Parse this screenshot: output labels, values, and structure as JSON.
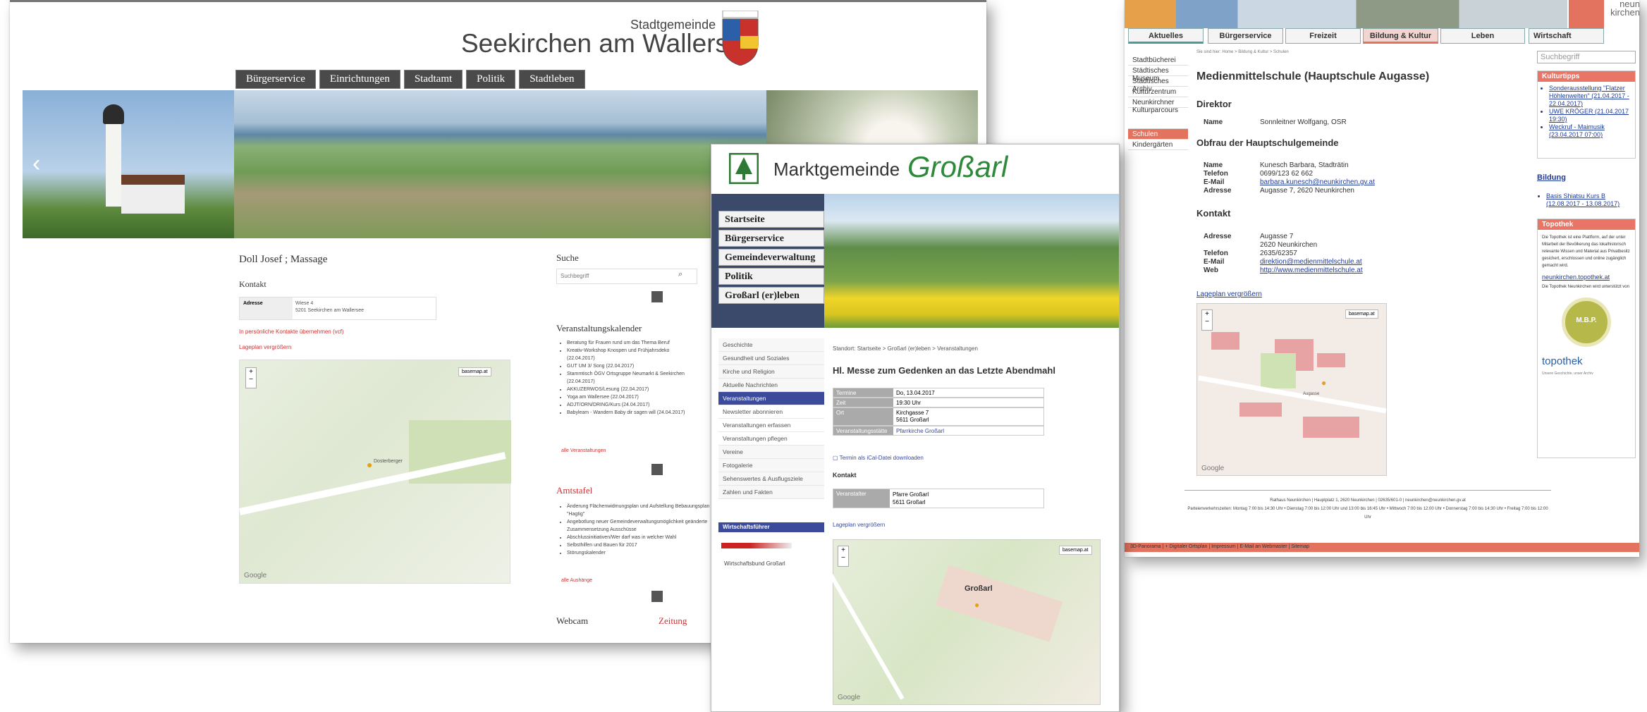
{
  "seekirchen": {
    "title_sub": "Stadtgemeinde",
    "title_main": "Seekirchen am Wallersee",
    "nav": [
      "Bürgerservice",
      "Einrichtungen",
      "Stadtamt",
      "Politik",
      "Stadtleben"
    ],
    "page_title": "Doll Josef ; Massage",
    "kontakt": "Kontakt",
    "adresse_label": "Adresse",
    "adresse_value": [
      "Wiese 4",
      "5201 Seekirchen am Wallersee"
    ],
    "vcard": "In persönliche Kontakte übernehmen (vcf)",
    "lageplan": "Lageplan vergrößern",
    "map_type": "basemap.at",
    "map_place": "Dosterberger",
    "google": "Google",
    "suche": "Suche",
    "suchbegriff": "Suchbegriff",
    "kalender_title": "Veranstaltungskalender",
    "kalender": [
      "Beratung für Frauen rund um das Thema Beruf",
      "Kreativ-Workshop Knospen und Frühjahrsdeko",
      "(22.04.2017)",
      "GUT UM 3/ Song (22.04.2017)",
      "Stammtisch ÖGV Ortsgruppe Neumarkt & Seekirchen",
      "(22.04.2017)",
      "AKKUZERWOS/Lesung (22.04.2017)",
      "Yoga am Wallersee (22.04.2017)",
      "ADJT/ORN/DRING/Kurs (24.04.2017)",
      "Babyleam - Wandern Baby dir sagen will (24.04.2017)"
    ],
    "alle_v": "alle Veranstaltungen",
    "amtstafel": "Amtstafel",
    "amt_items": [
      "Änderung Flächenwidmungsplan und Aufstellung Bebauungsplan \"Hagtig\"",
      "Angebotlung neuer Gemeindeverwaltungsmöglichkeit geänderte Zusammensetzung Ausschüsse",
      "Abschlussinitiativen/Wer darf was in welcher Wahl",
      "Selbsthilfen und Bauen für 2017",
      "Störungskalender"
    ],
    "alle_a": "alle Aushänge",
    "webcam": "Webcam",
    "zeitung": "Zeitung"
  },
  "grossarl": {
    "logo_prefix": "Marktgemeinde",
    "logo_name": "Großarl",
    "main_nav": [
      "Startseite",
      "Bürgerservice",
      "Gemeindeverwaltung",
      "Politik",
      "Großarl (er)leben"
    ],
    "sub_nav": [
      "Geschichte",
      "Gesundheit und Soziales",
      "Kirche und Religion",
      "Aktuelle Nachrichten",
      "Veranstaltungen",
      "Newsletter abonnieren",
      "Veranstaltungen erfassen",
      "Veranstaltungen pflegen",
      "Vereine",
      "Fotogalerie",
      "Sehenswertes & Ausflugsziele",
      "Zahlen und Fakten"
    ],
    "wf_title": "Wirtschaftsführer",
    "wf_item": "Wirtschaftsbund Großarl",
    "breadcrumb": "Standort: Startseite > Großarl (er)leben > Veranstaltungen",
    "page_title": "Hl. Messe zum Gedenken an das Letzte Abendmahl",
    "rows": [
      {
        "k": "Termine",
        "v": "Do, 13.04.2017"
      },
      {
        "k": "Zeit",
        "v": "19:30 Uhr"
      },
      {
        "k": "Ort",
        "v": "Kirchgasse 7\n5611 Großarl"
      },
      {
        "k": "Veranstaltungsstätte",
        "v": "Pfarrkirche Großarl"
      }
    ],
    "ical": "Termin als iCal-Datei downloaden",
    "kontakt": "Kontakt",
    "veranstalter_k": "Veranstalter",
    "veranstalter_v": "Pfarre Großarl\n5611 Großarl",
    "lageplan": "Lageplan vergrößern",
    "map_type": "basemap.at",
    "map_place": "Großarl",
    "google": "Google"
  },
  "neunkirchen": {
    "tabs": [
      "Aktuelles",
      "Bürgerservice",
      "Freizeit",
      "Bildung & Kultur",
      "Leben",
      "Wirtschaft"
    ],
    "logo": [
      "neun",
      "kirchen"
    ],
    "breadcrumb": "Sie sind hier: Home > Bildung & Kultur > Schulen",
    "left_nav": [
      "Stadtbücherei",
      "Städtisches Museum",
      "Städtisches Archiv",
      "Kulturzentrum",
      "Neunkirchner Kulturparcours",
      "Schulen",
      "Kindergärten"
    ],
    "page_title": "Medienmittelschule (Hauptschule Augasse)",
    "direktor": "Direktor",
    "dir_name_k": "Name",
    "dir_name_v": "Sonnleitner Wolfgang, OSR",
    "obfrau": "Obfrau der Hauptschulgemeinde",
    "ob_rows": [
      {
        "k": "Name",
        "v": "Kunesch Barbara, Stadträtin"
      },
      {
        "k": "Telefon",
        "v": "0699/123 62 662"
      },
      {
        "k": "E-Mail",
        "v": "barbara.kunesch@neunkirchen.gv.at"
      },
      {
        "k": "Adresse",
        "v": "Augasse 7, 2620 Neunkirchen"
      }
    ],
    "kontakt": "Kontakt",
    "k_rows": [
      {
        "k": "Adresse",
        "v": "Augasse 7\n2620 Neunkirchen"
      },
      {
        "k": "Telefon",
        "v": "2635/62357"
      },
      {
        "k": "E-Mail",
        "v": "direktion@medienmittelschule.at"
      },
      {
        "k": "Web",
        "v": "http://www.medienmittelschule.at"
      }
    ],
    "lageplan": "Lageplan vergrößern",
    "map_type": "basemap.at",
    "map_street": "Augasse",
    "google": "Google",
    "footer1": "Rathaus Neunkirchen | Hauptplatz 1, 2620 Neunkirchen | 02635/601-0 | neunkirchen@neunkirchen.gv.at",
    "footer2": "Parteienverkehrszeiten: Montag 7:00 bis 14:30 Uhr • Dienstag 7:00 bis 12:00 Uhr und 13:00 bis 16:45 Uhr • Mittwoch 7:00 bis 12:00 Uhr • Donnerstag 7:00 bis 14:30 Uhr • Freitag 7:00 bis 12:00 Uhr",
    "bottom_bar": "3D-Panorama | + Digitaler Ortsplan | Impressum | E-Mail an Webmaster | Sitemap",
    "suchbegriff": "Suchbegriff",
    "kulturtipps": "Kulturtipps",
    "kt_items": [
      "Sonderausstellung \"Flatzer Höhlenwelten\" (21.04.2017 - 22.04.2017)",
      "UWE KRÖGER (21.04.2017 19:30)",
      "Weckruf - Maimusik (23.04.2017 07:00)"
    ],
    "bildung": "Bildung",
    "bildung_items": [
      "Basis Shiatsu Kurs B (12.08.2017 - 13.08.2017)"
    ],
    "topothek": "Topothek",
    "topo_text": "Die Topothek ist eine Plattform, auf der unter Mitarbeit der Bevölkerung das lokalhistorisch relevante Wissen und Material aus Privatbesitz gesichert, erschlossen und online zugänglich gemacht wird.",
    "topo_link": "neunkirchen.topothek.at",
    "topo_text2": "Die Topothek Neunkirchen wird unterstützt von",
    "mbp": "M.B.P.",
    "topo_logo": "topothek",
    "topo_small": "Unsere Geschichte, unser Archiv"
  }
}
